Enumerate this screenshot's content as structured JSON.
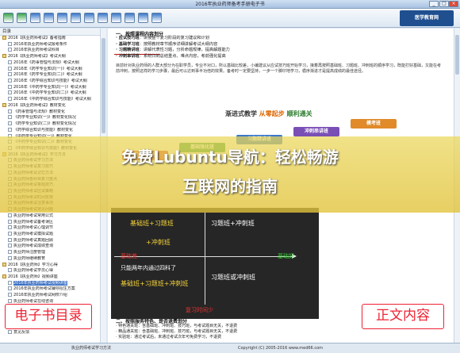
{
  "window": {
    "title": "2016年执业药师备考手册电子书",
    "min_label": "_",
    "max_label": "□",
    "close_label": "×",
    "logo_text": "医学教育网"
  },
  "toolbar": {
    "buttons": [
      {
        "name": "back",
        "color": "#3aa34a"
      },
      {
        "name": "forward",
        "color": "#3aa34a"
      },
      {
        "name": "home",
        "color": "#3a77c9"
      },
      {
        "name": "print",
        "color": "#3a77c9"
      },
      {
        "name": "zoom-in",
        "color": "#3a77c9"
      },
      {
        "name": "zoom-out",
        "color": "#3a77c9"
      },
      {
        "name": "toc",
        "color": "#3a77c9"
      },
      {
        "name": "bookmark",
        "color": "#3a77c9"
      },
      {
        "name": "search",
        "color": "#3a77c9"
      },
      {
        "name": "find",
        "color": "#3a77c9"
      },
      {
        "name": "help",
        "color": "#3a77c9"
      },
      {
        "name": "about",
        "color": "#3a77c9"
      }
    ]
  },
  "sidebar": {
    "header": "目录",
    "items": [
      {
        "label": "2016【执业药师考试】备考指南",
        "indent": 0,
        "folder": true
      },
      {
        "label": "2016年执业药师考试报考条件",
        "indent": 1
      },
      {
        "label": "2016年执业药师考试科目",
        "indent": 1
      },
      {
        "label": "2016【执业药师考试】考试大纲",
        "indent": 0,
        "folder": true
      },
      {
        "label": "2016年《药事管理与法规》考试大纲",
        "indent": 1
      },
      {
        "label": "2016年《药学专业知识(一)》考试大纲",
        "indent": 1
      },
      {
        "label": "2016年《药学专业知识(二)》考试大纲",
        "indent": 1
      },
      {
        "label": "2016年《药学综合知识与技能》考试大纲",
        "indent": 1
      },
      {
        "label": "2016年《中药学专业知识(一)》考试大纲",
        "indent": 1
      },
      {
        "label": "2016年《中药学专业知识(二)》考试大纲",
        "indent": 1
      },
      {
        "label": "2016年《中药学综合知识与技能》考试大纲",
        "indent": 1
      },
      {
        "label": "2016【执业药师考试】教材变化",
        "indent": 0,
        "folder": true
      },
      {
        "label": "《药事管理与法规》教材变化",
        "indent": 1
      },
      {
        "label": "《药学专业知识(一)》教材变化情况",
        "indent": 1
      },
      {
        "label": "《药学专业知识(二)》教材变化情况",
        "indent": 1
      },
      {
        "label": "《药学综合知识与技能》教材变化",
        "indent": 1
      },
      {
        "label": "《中药学专业知识(一)》教材变化",
        "indent": 1
      },
      {
        "label": "《中药学专业知识(二)》教材变化",
        "indent": 1
      },
      {
        "label": "《中药学综合知识与技能》教材变化",
        "indent": 1
      },
      {
        "label": "2016【执业药师考试】学习方法",
        "indent": 0,
        "folder": true
      },
      {
        "label": "执业药师考试学习方法",
        "indent": 1
      },
      {
        "label": "执业药师考试复习技巧",
        "indent": 1
      },
      {
        "label": "执业药师考试记忆方法",
        "indent": 1
      },
      {
        "label": "执业药师各科目复习重点",
        "indent": 1
      },
      {
        "label": "执业药师考试答题技巧",
        "indent": 1
      },
      {
        "label": "执业药师考试应试策略",
        "indent": 1
      },
      {
        "label": "执业药师考试时间安排",
        "indent": 1
      },
      {
        "label": "执业药师考试注意事项",
        "indent": 1
      },
      {
        "label": "执业药师考试常见问题",
        "indent": 1
      },
      {
        "label": "执业药师考试常用公式",
        "indent": 1
      },
      {
        "label": "执业药师考试备考误区",
        "indent": 1
      },
      {
        "label": "执业药师考试心理调节",
        "indent": 1
      },
      {
        "label": "执业药师考试模拟试题",
        "indent": 1
      },
      {
        "label": "执业药师考试真题回顾",
        "indent": 1
      },
      {
        "label": "执业药师考试成绩查询",
        "indent": 1
      },
      {
        "label": "执业药师注册管理",
        "indent": 1
      },
      {
        "label": "执业药师继续教育",
        "indent": 1
      },
      {
        "label": "2016【执业药师】学习心得",
        "indent": 0,
        "folder": true
      },
      {
        "label": "执业药师考试学员心得",
        "indent": 1
      },
      {
        "label": "2016【执业药师】视频讲座",
        "indent": 0,
        "folder": true
      },
      {
        "label": "2016年执业药师考试视频讲座",
        "indent": 1,
        "selected": true
      },
      {
        "label": "2016年执业药师考试辅导招生方案",
        "indent": 1
      },
      {
        "label": "2016年执业药师考试网校介绍",
        "indent": 1
      },
      {
        "label": "执业药师考试在线咨询",
        "indent": 1
      },
      {
        "label": "联系我们",
        "indent": 1
      },
      {
        "label": "版权声明",
        "indent": 1
      },
      {
        "label": "免责声明",
        "indent": 1
      },
      {
        "label": "常见问题解答",
        "indent": 1
      },
      {
        "label": "意见反馈",
        "indent": 1
      }
    ]
  },
  "content": {
    "heading1": "一、按照课程内容划分",
    "bullets": [
      {
        "title": "· 应试技巧班",
        "text": "：讲授整个复习阶段的复习建议和计划"
      },
      {
        "title": "· 基础学习班",
        "text": "：按照教材章节顺序详细讲解考试大纲内容"
      },
      {
        "title": "· 习题精讲班",
        "text": "：讲解代表性习题，分析命题规律，提高解题能力"
      },
      {
        "title": "· 冲刺串讲班",
        "text": "：系统归纳总结重点、难点内容，考前强化提高"
      }
    ],
    "para1": "目前针对执业药师的人群大部分为在职学员，专业不对口，所以基础比较差，小编建议从应试技巧班开始学习，接着再按照基础班、习题班、冲刺班的顺序学习，既能打好基础，又能在考前冲刺，按照这样的学习步骤，最后可以达到事半功倍的效果。备考时一定要坚持，一步一个脚印地学习，循序渐进才是提高成绩的最佳途径。",
    "diagram": {
      "title_pre": "渐进式教学 ",
      "title_em": "从零起步",
      "title_i": " 顺利通关",
      "boxes": [
        {
          "label": "应试技巧班",
          "color": "#e0473a"
        },
        {
          "label": "基础强化班",
          "color": "#3aa34a"
        },
        {
          "label": "习题精讲班",
          "color": "#3a77c9"
        },
        {
          "label": "冲刺串讲班",
          "color": "#7a4fb5"
        },
        {
          "label": "模考班",
          "color": "#e08a2a"
        }
      ]
    },
    "overlay_line1": "免费Lubuntu导航：轻松畅游",
    "overlay_line2": "互联网的指南",
    "quadrant": {
      "tl": "基础班+习题班",
      "tl2": "+冲刺班",
      "tr": "习题班+冲刺班",
      "bl_note": "只能两年内通过四科了",
      "bl": "基础班+习题班+冲刺班",
      "br": "习题班或冲刺班",
      "left_label": "基础差",
      "right_label": "基础好",
      "bottom_label": "复习时间少"
    },
    "heading2": "二、按照服务特色、是否退费划分",
    "bottom_lines": [
      "· 特色通关班：含基础班、冲刺班、技巧班，与考试题目无关，不退费",
      "· 精品通关班：含基础班、冲刺班、技巧班，与考试题目无关，不退费",
      "· 实验班：通过考试后，未通过考试次年可免费学习，不退费"
    ],
    "left_callout": "电子书目录",
    "right_callout": "正文内容"
  },
  "statusbar": {
    "left": "执业药师考试学习方法",
    "right": "Copyright (C) 2005-2016 www.med66.com"
  }
}
